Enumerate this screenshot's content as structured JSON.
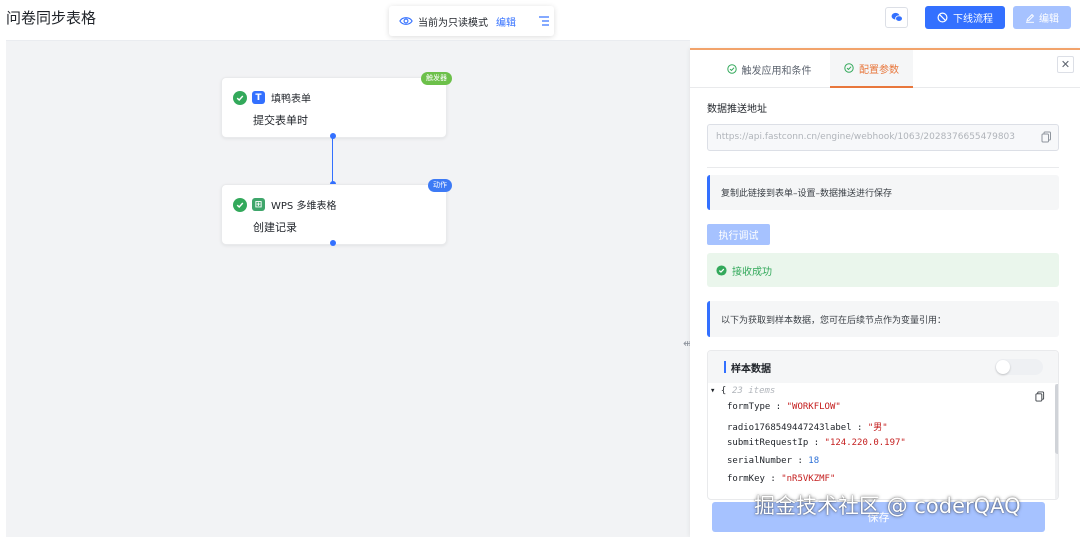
{
  "app": {
    "title": "问卷同步表格"
  },
  "mode_bar": {
    "text": "当前为只读模式",
    "edit_link": "编辑"
  },
  "header_buttons": {
    "offline": "下线流程",
    "edit": "编辑"
  },
  "flow": {
    "nodes": [
      {
        "app_name": "填鸭表单",
        "action": "提交表单时",
        "badge": "触发器",
        "badge_color": "#6cc04a",
        "icon_color": "#3370ff",
        "icon_glyph": "T",
        "icon": "form-app-icon"
      },
      {
        "app_name": "WPS 多维表格",
        "action": "创建记录",
        "badge": "动作",
        "badge_color": "#3d7af5",
        "icon_color": "#3fa66b",
        "icon_glyph": "⊞",
        "icon": "wps-table-icon"
      }
    ]
  },
  "panel": {
    "tabs": [
      {
        "label": "触发应用和条件",
        "active": false
      },
      {
        "label": "配置参数",
        "active": true
      }
    ],
    "url_label": "数据推送地址",
    "url_value": "https://api.fastconn.cn/engine/webhook/1063/2028376655479803",
    "tip_copy": "复制此链接到表单–设置–数据推送进行保存",
    "debug_button": "执行调试",
    "success_text": "接收成功",
    "tip_sample": "以下为获取到样本数据，您可在后续节点作为变量引用：",
    "sample": {
      "title": "样本数据",
      "open_brace": "{",
      "count": "23 items",
      "rows": [
        {
          "key": "formType",
          "value": "\"WORKFLOW\"",
          "type": "string"
        },
        {
          "key": "radio1768549447243label",
          "value": "\"男\"",
          "type": "string"
        },
        {
          "key": "submitRequestIp",
          "value": "\"124.220.0.197\"",
          "type": "string"
        },
        {
          "key": "serialNumber",
          "value": "18",
          "type": "number"
        },
        {
          "key": "formKey",
          "value": "\"nR5VKZMF\"",
          "type": "string"
        }
      ]
    },
    "save_button": "保存"
  },
  "watermark": "掘金技术社区 @ coderQAQ",
  "colors": {
    "accent": "#3370ff",
    "accent_disabled": "#a6c2ff",
    "active_tab": "#e8773c",
    "success": "#33a95b"
  }
}
